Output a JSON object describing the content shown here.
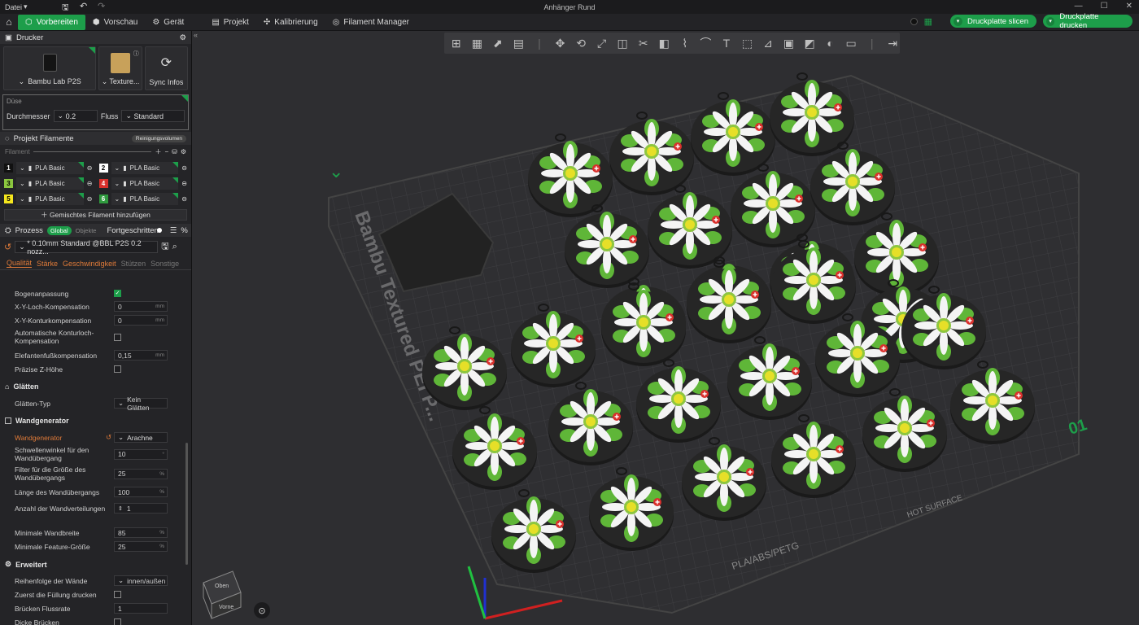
{
  "titlebar": {
    "menu_label": "Datei",
    "title": "Anhänger Rund"
  },
  "toolbar": {
    "tabs": [
      "Vorbereiten",
      "Vorschau",
      "Gerät"
    ],
    "items": [
      "Projekt",
      "Kalibrierung",
      "Filament Manager"
    ],
    "slice_label": "Druckplatte slicen",
    "print_label": "Druckplatte drucken"
  },
  "printer": {
    "section": "Drucker",
    "printer_name": "Bambu Lab P2S",
    "plate_name": "Texture...",
    "sync_label": "Sync Infos",
    "nozzle_title": "Düse",
    "diameter_label": "Durchmesser",
    "diameter_value": "0.2",
    "flow_label": "Fluss",
    "flow_value": "Standard"
  },
  "filaments": {
    "section": "Projekt Filamente",
    "purge_label": "Reinigungsvolumen",
    "filter_label": "Filament",
    "items": [
      {
        "num": "1",
        "color": "#111111",
        "text": "#ffffff",
        "name": "PLA Basic"
      },
      {
        "num": "2",
        "color": "#ffffff",
        "text": "#000000",
        "name": "PLA Basic"
      },
      {
        "num": "3",
        "color": "#8bc63f",
        "text": "#000000",
        "name": "PLA Basic"
      },
      {
        "num": "4",
        "color": "#d9302c",
        "text": "#ffffff",
        "name": "PLA Basic"
      },
      {
        "num": "5",
        "color": "#f5e61e",
        "text": "#000000",
        "name": "PLA Basic"
      },
      {
        "num": "6",
        "color": "#2f9a3e",
        "text": "#ffffff",
        "name": "PLA Basic"
      }
    ],
    "mix_label": "Gemischtes Filament hinzufügen"
  },
  "process": {
    "section": "Prozess",
    "global_label": "Global",
    "objects_label": "Objekte",
    "advanced_label": "Fortgeschritten",
    "profile": "* 0.10mm Standard @BBL P2S 0.2 nozz...",
    "tabs": [
      "Qualität",
      "Stärke",
      "Geschwindigkeit",
      "Stützen",
      "Sonstige"
    ]
  },
  "params": {
    "p1": {
      "label": "Bogenanpassung"
    },
    "p2": {
      "label": "X-Y-Loch-Kompensation",
      "value": "0",
      "unit": "mm"
    },
    "p3": {
      "label": "X-Y-Konturkompensation",
      "value": "0",
      "unit": "mm"
    },
    "p4": {
      "label": "Automatische Konturloch-Kompensation"
    },
    "p5": {
      "label": "Elefantenfußkompensation",
      "value": "0,15",
      "unit": "mm"
    },
    "p6": {
      "label": "Präzise Z-Höhe"
    },
    "g1": "Glätten",
    "p7": {
      "label": "Glätten-Typ",
      "value": "Kein Glätten"
    },
    "g2": "Wandgenerator",
    "p8": {
      "label": "Wandgenerator",
      "value": "Arachne"
    },
    "p9": {
      "label": "Schwellenwinkel für den Wandübergang",
      "value": "10",
      "unit": "°"
    },
    "p10": {
      "label": "Filter für die Größe des Wandübergangs",
      "value": "25",
      "unit": "%"
    },
    "p11": {
      "label": "Länge des Wandübergangs",
      "value": "100",
      "unit": "%"
    },
    "p12": {
      "label": "Anzahl der Wandverteilungen",
      "value": "1"
    },
    "p13": {
      "label": "Minimale Wandbreite",
      "value": "85",
      "unit": "%"
    },
    "p14": {
      "label": "Minimale Feature-Größe",
      "value": "25",
      "unit": "%"
    },
    "g3": "Erweitert",
    "p15": {
      "label": "Reihenfolge der Wände",
      "value": "innen/außen"
    },
    "p16": {
      "label": "Zuerst die Füllung drucken"
    },
    "p17": {
      "label": "Brücken Flussrate",
      "value": "1"
    },
    "p18": {
      "label": "Dicke Brücken"
    }
  },
  "plate": {
    "brand_text": "Bambu Textured PEI P...",
    "material_text": "PLA/ABS/PETG",
    "hot_text": "HOT SURFACE",
    "plate_number": "01",
    "cube_top": "Oben",
    "cube_front": "Vorne"
  }
}
